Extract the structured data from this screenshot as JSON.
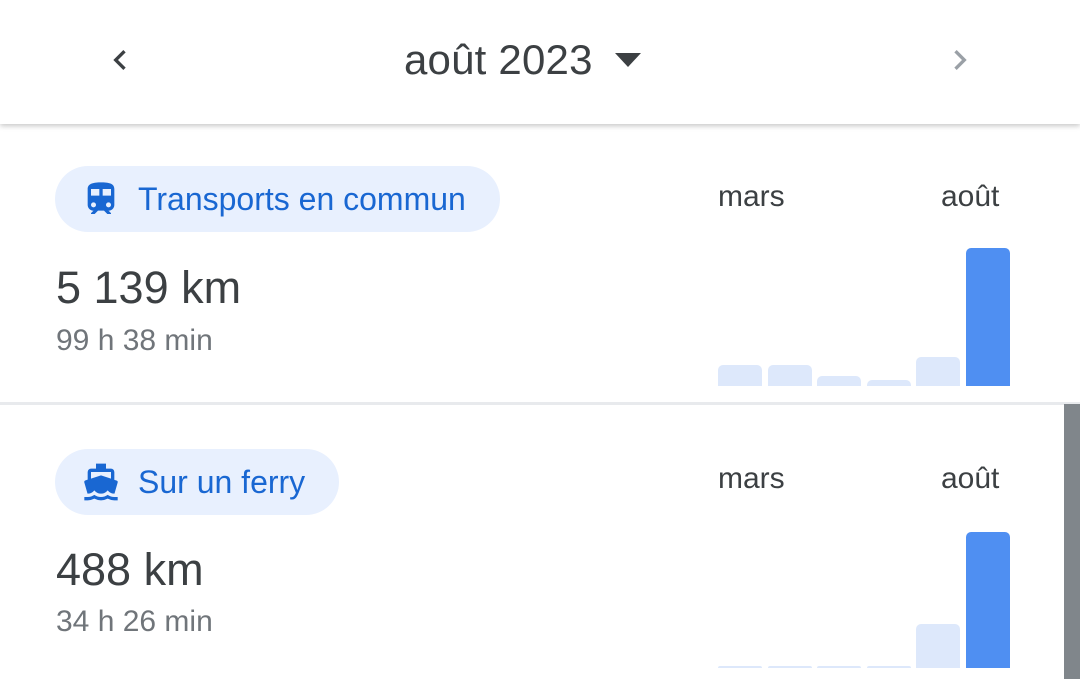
{
  "header": {
    "month": "août 2023",
    "prev_icon": "chevron-left-icon",
    "next_icon": "chevron-right-icon",
    "dropdown_icon": "arrow-drop-down-icon"
  },
  "colors": {
    "chip_bg": "#e8f0fe",
    "chip_text": "#1967d2",
    "bar_current": "#4f8ff2",
    "bar_past": "#dde8fb",
    "scrollbar": "#80868b"
  },
  "activities": [
    {
      "label": "Transports en commun",
      "icon": "train-icon",
      "distance": "5 139 km",
      "duration": "99 h 38 min",
      "chart_start_label": "mars",
      "chart_end_label": "août",
      "bars_relative": [
        0.15,
        0.15,
        0.07,
        0.04,
        0.21,
        1.0
      ]
    },
    {
      "label": "Sur un ferry",
      "icon": "ferry-icon",
      "distance": "488 km",
      "duration": "34 h 26 min",
      "chart_start_label": "mars",
      "chart_end_label": "août",
      "bars_relative": [
        0.01,
        0.01,
        0.01,
        0.01,
        0.32,
        1.0
      ]
    }
  ]
}
